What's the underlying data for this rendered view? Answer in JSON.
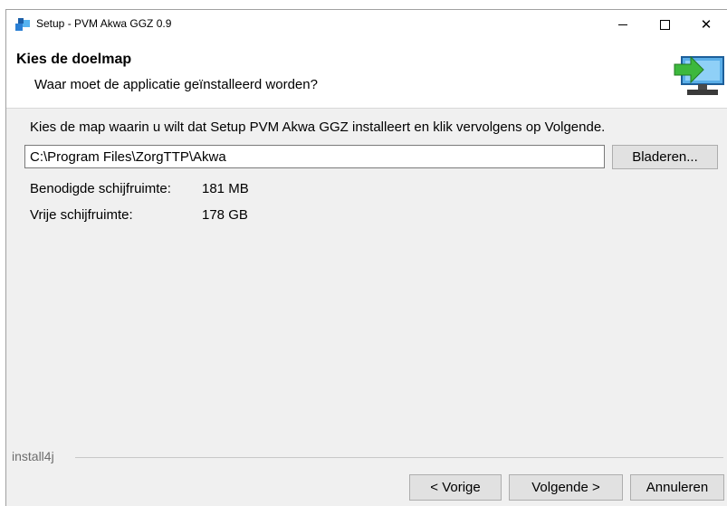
{
  "window": {
    "title": "Setup - PVM Akwa GGZ 0.9",
    "app_icon": "setup-app-icon",
    "controls": {
      "minimize_icon": "minimize-icon",
      "maximize_icon": "maximize-icon",
      "close_glyph": "✕"
    }
  },
  "header": {
    "title": "Kies de doelmap",
    "subtitle": "Waar moet de applicatie geïnstalleerd worden?",
    "icon": "computer-install-icon",
    "accent_color": "#3db83d"
  },
  "content": {
    "instruction": "Kies de map waarin u wilt dat Setup PVM Akwa GGZ installeert en klik vervolgens op Volgende.",
    "destination_path": "C:\\Program Files\\ZorgTTP\\Akwa",
    "browse_label": "Bladeren...",
    "required_space": {
      "label": "Benodigde schijfruimte:",
      "value": "181 MB"
    },
    "free_space": {
      "label": "Vrije schijfruimte:",
      "value": "178 GB"
    }
  },
  "footer": {
    "brand": "install4j",
    "back_label": "< Vorige",
    "next_label": "Volgende >",
    "cancel_label": "Annuleren"
  }
}
